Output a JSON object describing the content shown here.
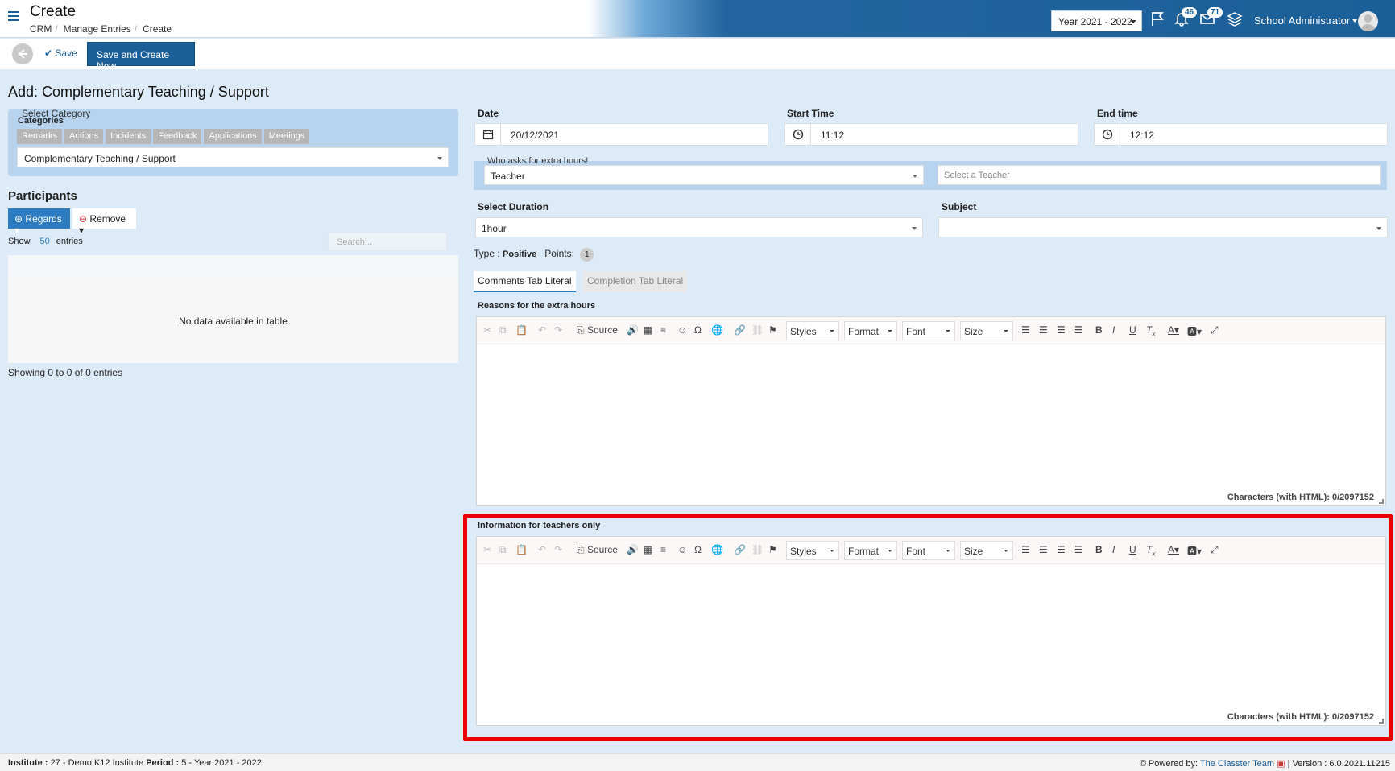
{
  "header": {
    "title": "Create",
    "breadcrumbs": [
      "CRM",
      "Manage Entries",
      "Create"
    ],
    "year": "Year 2021 - 2022",
    "notifications_count": "46",
    "messages_count": "71",
    "user_name": "School Administrator"
  },
  "actions": {
    "save": "Save",
    "save_and_new": "Save and Create New"
  },
  "form": {
    "title": "Add: Complementary Teaching / Support",
    "category_legend": "Select Category",
    "categories_label": "Categories",
    "category_tabs": [
      "Remarks",
      "Actions",
      "Incidents",
      "Feedback",
      "Applications",
      "Meetings"
    ],
    "category_value": "Complementary Teaching / Support",
    "date_label": "Date",
    "date_value": "20/12/2021",
    "start_label": "Start Time",
    "start_value": "11:12",
    "end_label": "End time",
    "end_value": "12:12",
    "who_legend": "Who asks for extra hours!",
    "who_value": "Teacher",
    "teacher_placeholder": "Select a Teacher",
    "duration_label": "Select Duration",
    "duration_value": "1hour",
    "subject_label": "Subject",
    "type_label": "Type :",
    "type_value": "Positive",
    "points_label": "Points:",
    "points_value": "1",
    "tab_comments": "Comments Tab Literal",
    "tab_completion": "Completion Tab Literal",
    "reasons_label": "Reasons for the extra hours",
    "info_label": "Information for teachers only",
    "charcount": "Characters (with HTML): 0/2097152"
  },
  "editor_toolbar": {
    "source": "Source",
    "styles": "Styles",
    "format": "Format",
    "font": "Font",
    "size": "Size"
  },
  "participants": {
    "title": "Participants",
    "regards": "Regards",
    "remove": "Remove",
    "show": "Show",
    "show_count": "50",
    "entries": "entries",
    "search_placeholder": "Search...",
    "empty": "No data available in table",
    "showing": "Showing 0 to 0 of 0 entries"
  },
  "footer": {
    "institute_label": "Institute :",
    "institute": "27 - Demo K12 Institute",
    "period_label": "Period :",
    "period": "5 - Year 2021 - 2022",
    "powered": "Powered by:",
    "team": "The Classter Team",
    "version": "| Version : 6.0.2021.11215"
  },
  "colors": {
    "brand": "#1b5f99",
    "panel": "#b7d3ee",
    "background": "#ddeaf7",
    "highlight": "#ee0000"
  }
}
